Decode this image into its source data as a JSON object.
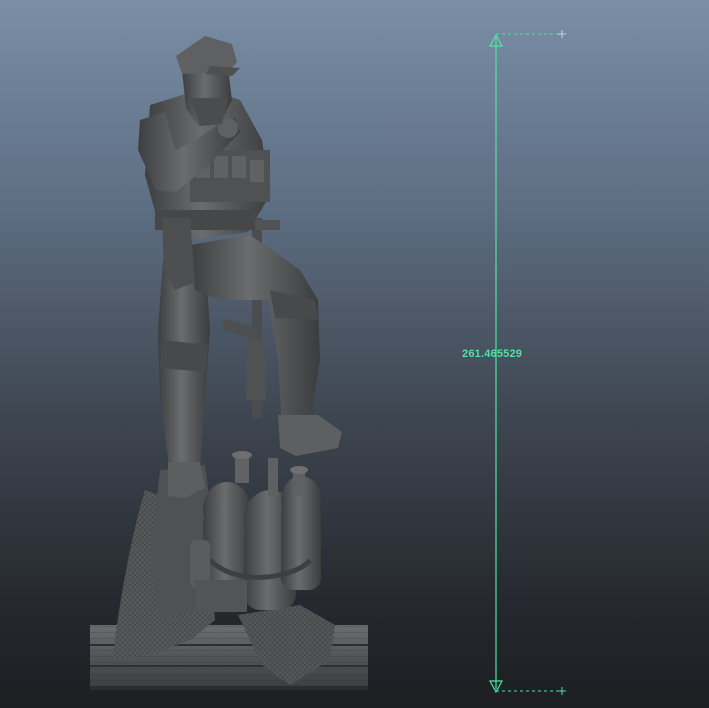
{
  "viewport": {
    "background_top_color": "#7a8ea6",
    "background_bottom_color": "#1d1f22",
    "model_color": "#555759"
  },
  "distance_tool": {
    "value": "261.465529",
    "color": "#4fe3a2",
    "start_locator_icon": "cross-locator-icon",
    "end_locator_icon": "cross-locator-icon",
    "arrow_top_icon": "triangle-arrow-up-icon",
    "arrow_bottom_icon": "triangle-arrow-down-icon"
  },
  "model": {
    "subject": "soldier-statue-model",
    "parts": [
      "cap",
      "head",
      "torso-vest",
      "arms",
      "rifle",
      "legs",
      "boots",
      "gas-cylinders",
      "draped-cloth",
      "wooden-crate-base"
    ]
  }
}
